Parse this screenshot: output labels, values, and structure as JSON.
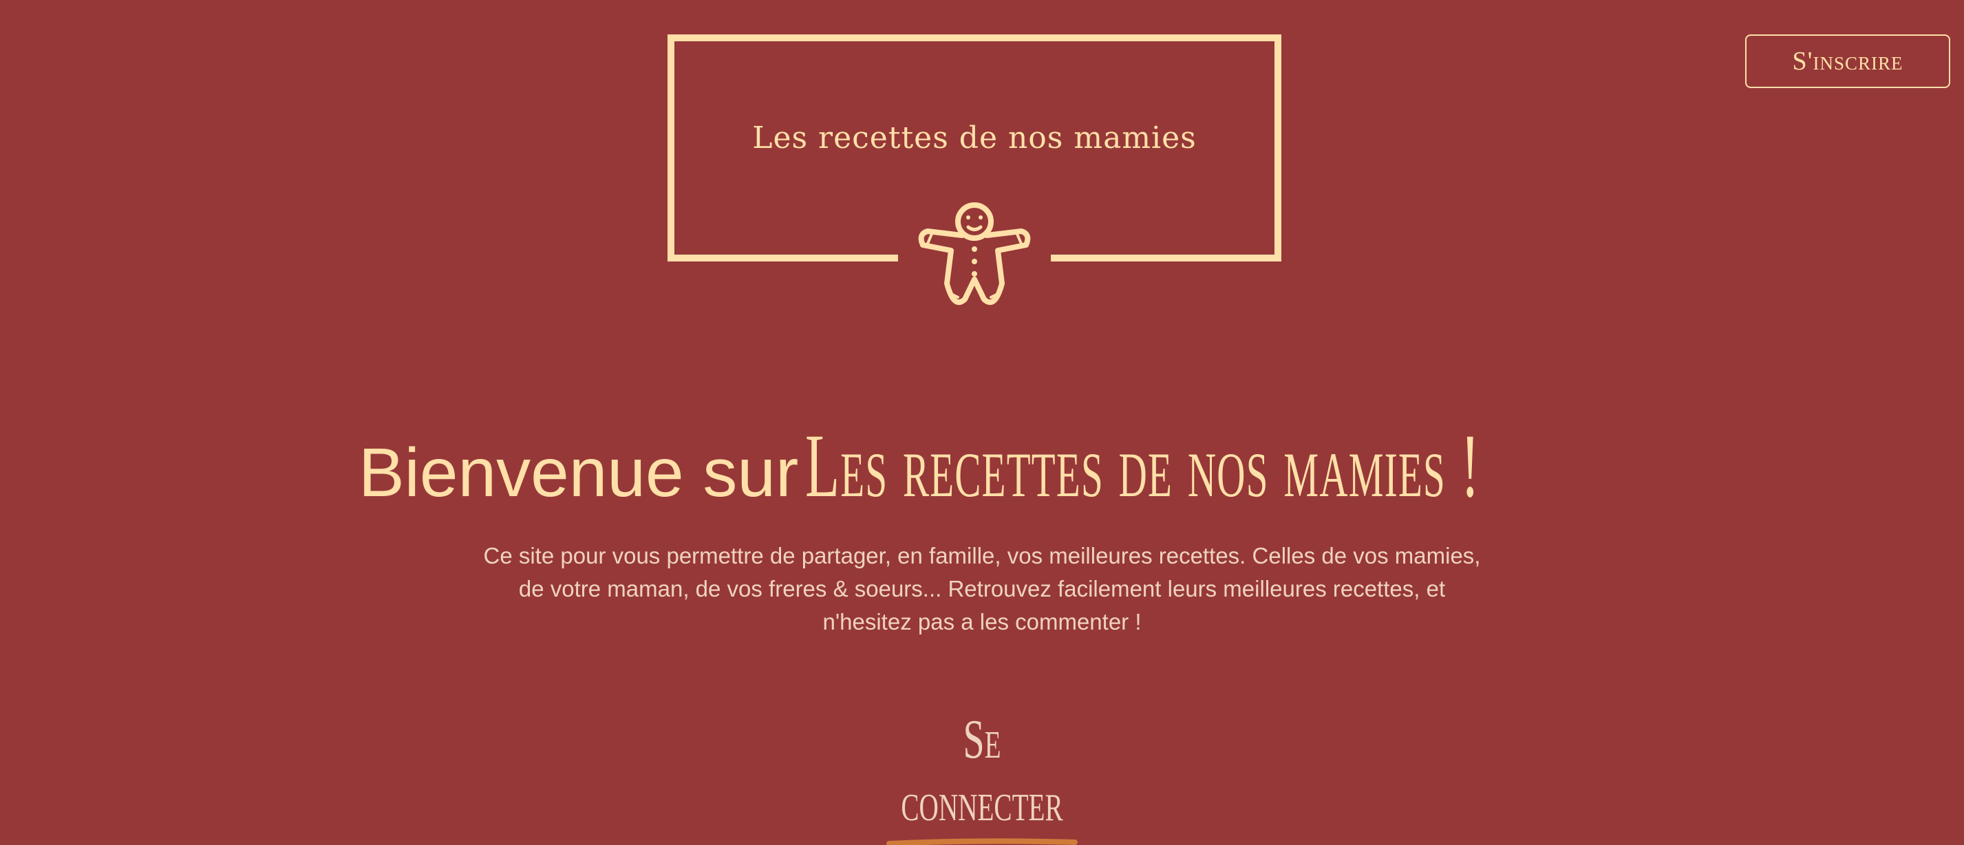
{
  "logo": {
    "title": "Les recettes de nos mamies",
    "icon": "gingerbread-man-icon"
  },
  "header": {
    "signup_label": "S'inscrire"
  },
  "hero": {
    "lead": "Bienvenue sur",
    "brand": "Les recettes de nos mamies !",
    "description": "Ce site pour vous permettre de partager, en famille, vos meilleures recettes. Celles de vos mamies, de votre maman, de vos freres & soeurs... Retrouvez facilement leurs meilleures recettes, et n'hesitez pas a les commenter !"
  },
  "actions": {
    "connect_label": "Se connecter"
  },
  "colors": {
    "background": "#963838",
    "accent": "#ffe0a8",
    "text_muted": "#f0d2c0",
    "underline": "#d07a3a"
  }
}
